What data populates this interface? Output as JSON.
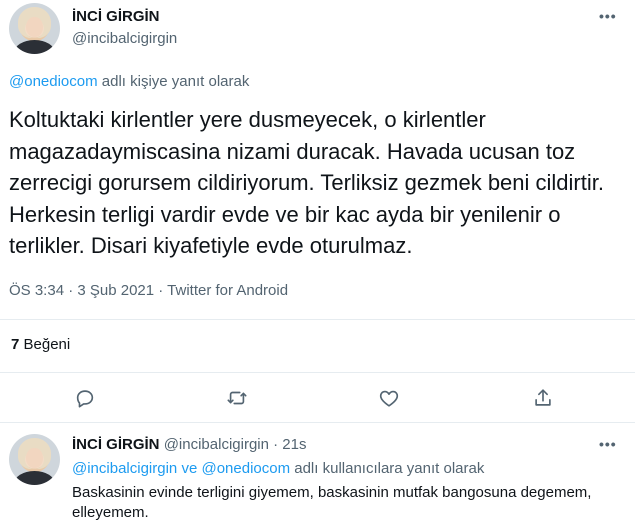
{
  "tweet": {
    "author_name": "İNCİ GİRGİN",
    "author_handle": "@incibalcigirgin",
    "more_icon": "more-icon",
    "reply_to": {
      "mention": "@onediocom",
      "suffix": "adlı kişiye yanıt olarak"
    },
    "text": "Koltuktaki kirlentler yere dusmeyecek, o kirlentler magazadaymiscasina nizami duracak. Havada ucusan toz zerrecigi gorursem cildiriyorum. Terliksiz gezmek beni cildirtir. Herkesin terligi vardir evde ve bir kac ayda bir yenilenir o terlikler. Disari kiyafetiyle evde oturulmaz.",
    "timestamp": "ÖS 3:34 · 3 Şub 2021 · Twitter for Android",
    "likes": {
      "count": "7",
      "label": "Beğeni"
    }
  },
  "actions": [
    {
      "name": "reply-button",
      "icon": "comment-icon"
    },
    {
      "name": "retweet-button",
      "icon": "retweet-icon"
    },
    {
      "name": "like-button",
      "icon": "heart-icon"
    },
    {
      "name": "share-button",
      "icon": "share-icon"
    }
  ],
  "reply": {
    "author_name": "İNCİ GİRGİN",
    "author_handle": "@incibalcigirgin",
    "time": "· 21s",
    "reply_to": {
      "mention1": "@incibalcigirgin",
      "connector": "ve",
      "mention2": "@onediocom",
      "suffix": "adlı kullanıcılara yanıt olarak"
    },
    "text": "Baskasinin evinde terligini giyemem, baskasinin mutfak bangosuna degemem, elleyemem."
  },
  "colors": {
    "accent": "#1d9bf0",
    "secondary_text": "#536471",
    "primary_text": "#0f1419",
    "divider": "#e6ecf0"
  }
}
